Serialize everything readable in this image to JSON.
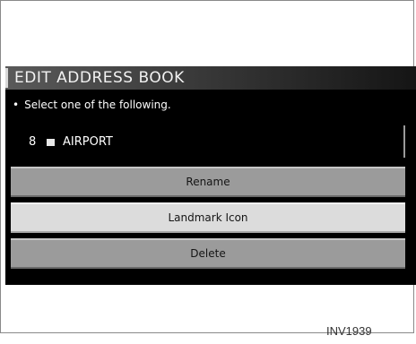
{
  "screen": {
    "title": "EDIT ADDRESS BOOK",
    "prompt": "Select one of the following.",
    "prompt_bullet": "•",
    "selected_entry": {
      "number": "8",
      "name": "AIRPORT"
    },
    "buttons": [
      {
        "label": "Rename",
        "highlighted": false
      },
      {
        "label": "Landmark Icon",
        "highlighted": true
      },
      {
        "label": "Delete",
        "highlighted": false
      }
    ]
  },
  "figure_caption": "INV1939"
}
